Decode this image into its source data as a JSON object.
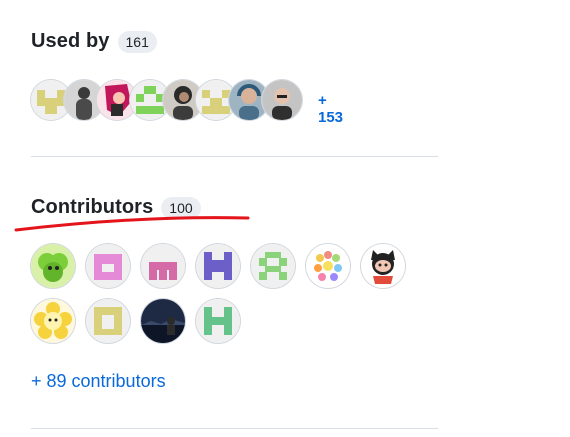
{
  "used_by": {
    "title": "Used by",
    "count": "161",
    "avatars": [
      {
        "kind": "identicon",
        "color": "#d8d07a",
        "icon": "identicon-avatar"
      },
      {
        "kind": "photo",
        "color": "#6b6b6b",
        "icon": "person-photo-avatar"
      },
      {
        "kind": "photo",
        "color": "#c2185b",
        "icon": "anime-avatar"
      },
      {
        "kind": "identicon",
        "color": "#7fd35b",
        "icon": "identicon-avatar"
      },
      {
        "kind": "photo",
        "color": "#3c3c3c",
        "icon": "person-photo-avatar"
      },
      {
        "kind": "identicon",
        "color": "#d8d07a",
        "icon": "identicon-avatar"
      },
      {
        "kind": "photo",
        "color": "#4a6f8a",
        "icon": "person-photo-avatar"
      },
      {
        "kind": "photo",
        "color": "#8a8a8a",
        "icon": "person-photo-avatar"
      }
    ],
    "more_label": "+ 153"
  },
  "contributors": {
    "title": "Contributors",
    "count": "100",
    "avatars": [
      {
        "icon": "clover-cartoon-avatar",
        "color": "#7ccf3a"
      },
      {
        "icon": "identicon-avatar",
        "color": "#e58ad6"
      },
      {
        "icon": "identicon-avatar",
        "color": "#d46aa6"
      },
      {
        "icon": "identicon-avatar",
        "color": "#6c5fc7"
      },
      {
        "icon": "identicon-avatar",
        "color": "#8ad37a"
      },
      {
        "icon": "lightbulbs-avatar",
        "color": "#f2c94c"
      },
      {
        "icon": "octocat-avatar",
        "color": "#222222"
      },
      {
        "icon": "flower-cartoon-avatar",
        "color": "#f6d23c"
      },
      {
        "icon": "identicon-avatar",
        "color": "#d8d07a"
      },
      {
        "icon": "night-photo-avatar",
        "color": "#1e2a44"
      },
      {
        "icon": "identicon-avatar",
        "color": "#66c28b"
      }
    ],
    "more_label": "+ 89 contributors"
  },
  "colors": {
    "link": "#0969da",
    "annotation": "#e3141b",
    "divider": "#d8dee4",
    "counter_bg": "#eaeef2"
  }
}
